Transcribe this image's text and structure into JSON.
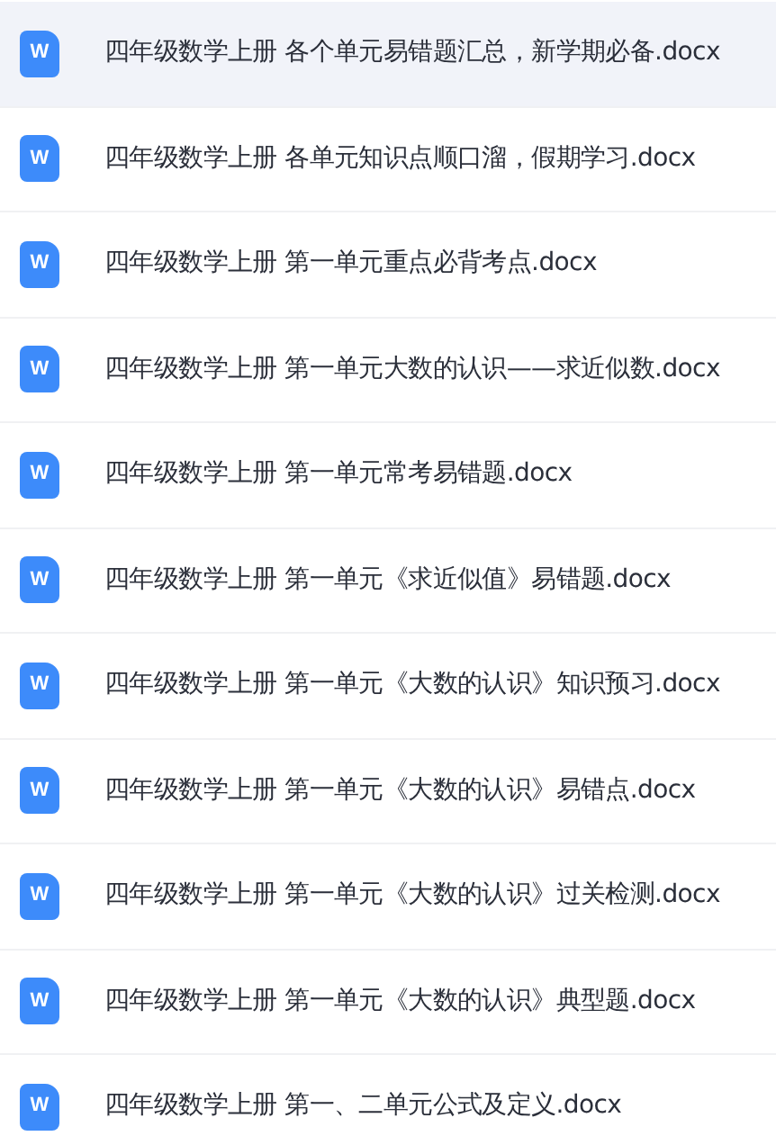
{
  "files": [
    {
      "name": "四年级数学上册 各个单元易错题汇总，新学期必备.docx",
      "icon_letter": "W",
      "selected": true
    },
    {
      "name": "四年级数学上册 各单元知识点顺口溜，假期学习.docx",
      "icon_letter": "W",
      "selected": false
    },
    {
      "name": "四年级数学上册 第一单元重点必背考点.docx",
      "icon_letter": "W",
      "selected": false
    },
    {
      "name": "四年级数学上册 第一单元大数的认识——求近似数.docx",
      "icon_letter": "W",
      "selected": false
    },
    {
      "name": "四年级数学上册 第一单元常考易错题.docx",
      "icon_letter": "W",
      "selected": false
    },
    {
      "name": "四年级数学上册 第一单元《求近似值》易错题.docx",
      "icon_letter": "W",
      "selected": false
    },
    {
      "name": "四年级数学上册 第一单元《大数的认识》知识预习.docx",
      "icon_letter": "W",
      "selected": false
    },
    {
      "name": "四年级数学上册 第一单元《大数的认识》易错点.docx",
      "icon_letter": "W",
      "selected": false
    },
    {
      "name": "四年级数学上册 第一单元《大数的认识》过关检测.docx",
      "icon_letter": "W",
      "selected": false
    },
    {
      "name": "四年级数学上册 第一单元《大数的认识》典型题.docx",
      "icon_letter": "W",
      "selected": false
    },
    {
      "name": "四年级数学上册 第一、二单元公式及定义.docx",
      "icon_letter": "W",
      "selected": false
    }
  ]
}
